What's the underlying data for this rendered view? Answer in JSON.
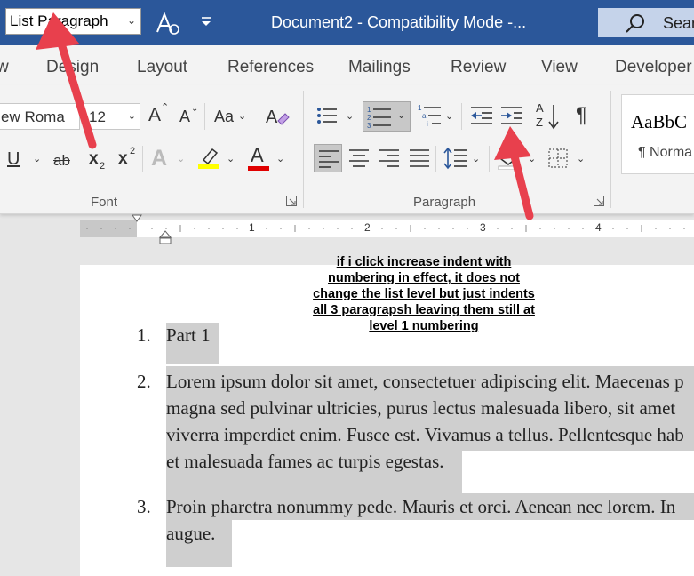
{
  "titlebar": {
    "style_value": "List Paragraph",
    "title": "Document2  -  Compatibility Mode  -...",
    "search_text": "Sear"
  },
  "tabs": [
    "w",
    "Design",
    "Layout",
    "References",
    "Mailings",
    "Review",
    "View",
    "Developer"
  ],
  "ribbon": {
    "font_name": "ew Roma",
    "font_size": "12",
    "grow_font": "A",
    "shrink_font": "A",
    "change_case": "Aa",
    "underline": "U",
    "strike": "ab",
    "subscript": "x",
    "superscript": "x",
    "sub_mark": "2",
    "sup_mark": "2",
    "text_effects": "A",
    "font_color": "A",
    "font_group_label": "Font",
    "paragraph_group_label": "Paragraph",
    "sort_a": "A",
    "sort_z": "Z",
    "pilcrow": "¶",
    "style_sample": "AaBbC",
    "style_name": "¶ Norma",
    "numbering_digits": [
      "1",
      "2",
      "3"
    ],
    "multilevel_digits": [
      "1",
      "a",
      "i"
    ]
  },
  "ruler": {
    "numbers": [
      "1",
      "2",
      "3",
      "4"
    ]
  },
  "annotation": [
    "if i click increase indent with",
    "numbering in effect, it does not",
    "change the list level  but just indents",
    "all 3 paragrapsh leaving them still at",
    "level 1 numbering"
  ],
  "document": {
    "items": [
      {
        "number": "1.",
        "lines": [
          "Part 1"
        ]
      },
      {
        "number": "2.",
        "lines": [
          "Lorem ipsum dolor sit amet, consectetuer adipiscing elit. Maecenas p",
          "magna sed pulvinar ultricies, purus lectus malesuada libero, sit amet",
          "viverra imperdiet enim. Fusce est. Vivamus a tellus. Pellentesque hab",
          "et malesuada fames ac turpis egestas."
        ]
      },
      {
        "number": "3.",
        "lines": [
          "Proin pharetra nonummy pede. Mauris et orci. Aenean nec lorem. In",
          "augue."
        ]
      }
    ]
  },
  "colors": {
    "title_bar": "#2b579a",
    "arrow": "#e8404d",
    "highlight": "#ffff00",
    "font_color": "#e00000",
    "selection": "#cfcfcf"
  }
}
